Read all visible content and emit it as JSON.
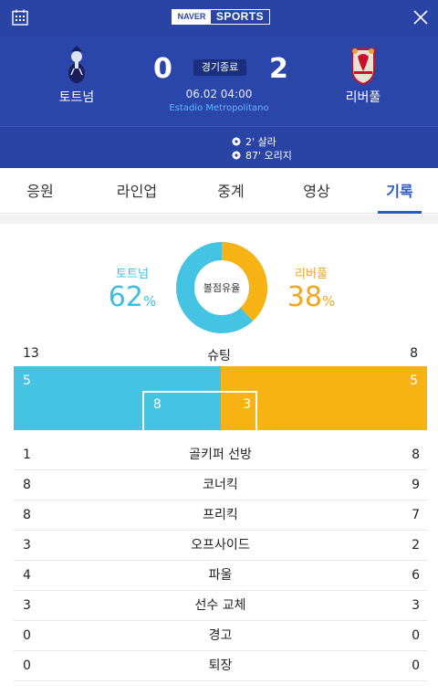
{
  "header": {
    "logo_left": "NAVER",
    "logo_right": "SPORTS"
  },
  "match": {
    "home": {
      "name": "토트넘",
      "score": "0",
      "crest": "tottenham-crest"
    },
    "away": {
      "name": "리버풀",
      "score": "2",
      "crest": "liverpool-crest"
    },
    "status": "경기종료",
    "datetime": "06.02 04:00",
    "venue": "Estadio Metropolitano",
    "goals": [
      {
        "text": "2' 살라"
      },
      {
        "text": "87' 오리지"
      }
    ]
  },
  "tabs": [
    {
      "label": "응원"
    },
    {
      "label": "라인업"
    },
    {
      "label": "중계"
    },
    {
      "label": "영상"
    },
    {
      "label": "기록"
    }
  ],
  "active_tab": "기록",
  "possession": {
    "label": "볼점유율",
    "home_name": "토트넘",
    "home_value": "62",
    "away_name": "리버풀",
    "away_value": "38",
    "unit": "%",
    "home_color": "#44c4e2",
    "away_color": "#f7b314"
  },
  "shots": {
    "label": "슈팅",
    "home_total": "13",
    "away_total": "8",
    "home_off_target": "5",
    "away_off_target": "5",
    "home_on_target": "8",
    "away_on_target": "3"
  },
  "stats": [
    {
      "label": "골키퍼 선방",
      "home": "1",
      "away": "8"
    },
    {
      "label": "코너킥",
      "home": "8",
      "away": "9"
    },
    {
      "label": "프리킥",
      "home": "8",
      "away": "7"
    },
    {
      "label": "오프사이드",
      "home": "3",
      "away": "2"
    },
    {
      "label": "파울",
      "home": "4",
      "away": "6"
    },
    {
      "label": "선수 교체",
      "home": "3",
      "away": "3"
    },
    {
      "label": "경고",
      "home": "0",
      "away": "0"
    },
    {
      "label": "퇴장",
      "home": "0",
      "away": "0"
    }
  ]
}
